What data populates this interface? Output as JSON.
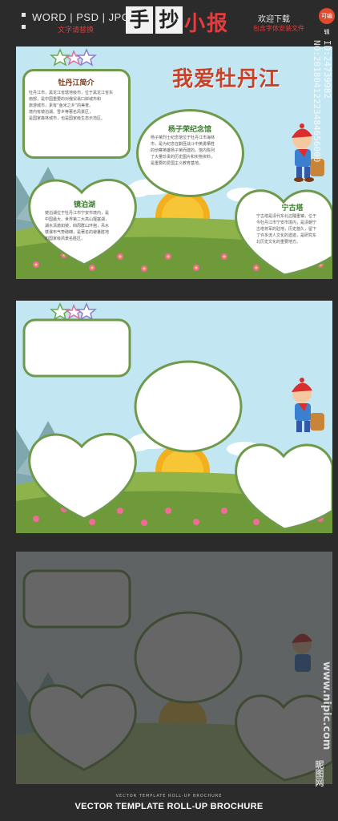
{
  "header": {
    "formats": "WORD | PSD | JPG",
    "formats_sub": "文字请替换",
    "title_boxes": [
      "手",
      "抄"
    ],
    "title_red": "小报",
    "welcome": "欢迎下载",
    "welcome_sub": "包含字体安装文件",
    "badge": "可编辑",
    "image_id": "ID:24739982 NO:20180412223484656000"
  },
  "page1": {
    "main_title": "我爱牡丹江",
    "box1": {
      "title": "牡丹江简介",
      "lines": [
        "牡丹江市，黑龙江省辖地级市，位于黑龙江省东",
        "南部，是中国重要的对俄贸易口岸城市和",
        "旅游城市，素有“鱼米之乡”的美誉。",
        "境内有镜泊湖、雪乡等著名风景区，",
        "是国家森林城市，也是国家级生态示范区。"
      ]
    },
    "box2": {
      "title": "杨子荣纪念馆",
      "lines": [
        "杨子荣烈士纪念馆位于牡丹江市海林",
        "市，是为纪念在剿匪战斗中英勇牺牲",
        "的侦察英雄杨子荣而建的。馆内陈列",
        "了大量珍贵的历史图片和实物资料，",
        "是重要的爱国主义教育基地。"
      ]
    },
    "box3": {
      "title": "镜泊湖",
      "lines": [
        "镜泊湖位于牡丹江市宁安市境内，是",
        "中国最大、世界第二大高山堰塞湖，",
        "湖水清澈如镜，四周群山环抱，吊水",
        "楼瀑布气势磅礴，是著名的避暑胜地",
        "和国家级风景名胜区。"
      ]
    },
    "box4": {
      "title": "宁古塔",
      "lines": [
        "宁古塔是清代东北边陲重镇，位于",
        "今牡丹江市宁安市境内，是清朝宁",
        "古塔将军的驻地，历史悠久，留下",
        "了许多流人文化的遗迹，是研究东",
        "北历史文化的重要地方。"
      ]
    }
  },
  "footer": {
    "sub": "VECTOR TEMPLATE ROLL-UP BROCHURE",
    "main": "VECTOR TEMPLATE ROLL-UP BROCHURE"
  },
  "watermark": {
    "site": "www.nipic.com",
    "brand": "昵图网"
  },
  "colors": {
    "sky": "#bfe4f3",
    "grass": "#6e9a3a",
    "frame": "#6f9a4b",
    "title_red": "#c8422a",
    "sun": "#f2b01e"
  }
}
